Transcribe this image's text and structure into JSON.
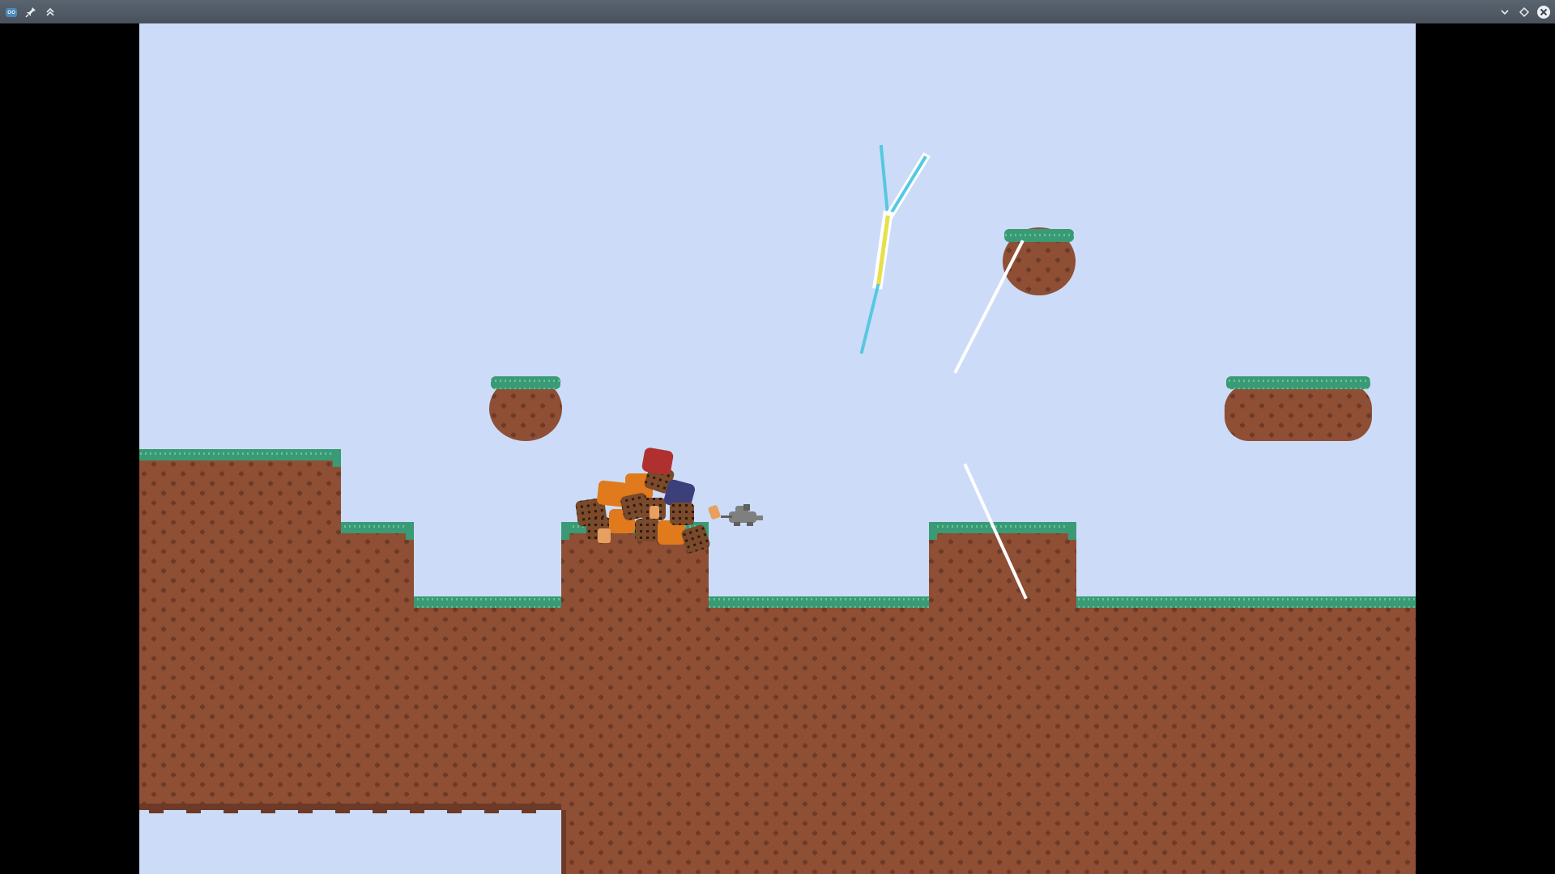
{
  "window": {
    "app_icon": "godot-icon",
    "controls_left": [
      "pin-icon",
      "keep-above-icon"
    ],
    "controls_right": [
      "minimize-icon",
      "maximize-icon",
      "close-icon"
    ]
  },
  "scene": {
    "colors": {
      "sky": "#ccdcf8",
      "dirt": "#8e4f35",
      "dirt_pattern": "#6e3a28",
      "grass": "#3a9a75",
      "grass_light": "#5ec59a"
    },
    "crates": {
      "colors": [
        "#e07a1c",
        "#7a4a2a",
        "#b03030",
        "#3d3f7a",
        "#e8a060"
      ]
    },
    "player": {
      "color": "#7f7f7f",
      "name": "mouse"
    },
    "effects": {
      "laser_colors": [
        "#56c8e0",
        "#ffffff",
        "#e6e04a"
      ]
    }
  }
}
